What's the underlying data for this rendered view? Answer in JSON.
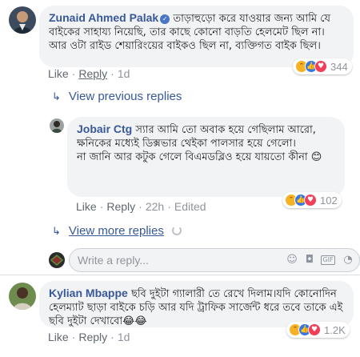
{
  "comments": [
    {
      "author": "Zunaid Ahmed Palak",
      "verified": true,
      "text": "তাড়াহুড়ো করে যাওয়ার জন্য আমি যে বাইকের সাহায্য নিয়েছি, তার কাছে কোনো বাড়তি হেলমেট ছিল না। আর ওটা রাইড শেয়ারিংয়ের বাইকও ছিল না, ব্যক্তিগত বাইক ছিল।",
      "like": "Like",
      "reply": "Reply",
      "time": "1d",
      "reaction_count": "344"
    },
    {
      "author": "Jobair Ctg",
      "text_lines": [
        "স্যার আমি তো অবাক হয়ে গেছিলাম আরো,",
        "ক্ষনিকের মধ্যেই ডিক্সভার থেইকা পালসার হয়ে গেলো।",
        "না জানি আর কটুক গেলে বিএমডব্লিও হয়ে যায়তো কীনা 😊"
      ],
      "like": "Like",
      "reply": "Reply",
      "time": "22h",
      "edited": "Edited",
      "reaction_count": "102"
    },
    {
      "author": "Kylian Mbappe",
      "text": "ছবি দুইটা গ্যালারী তে রেখে দিলাম।যদি কোনোদিন হেলম্যাট ছাড়া বাইকে চড়ি আর যদি ট্রাফিক সার্জেন্ট ধরে তবে তাকে এই ছবি দুইটা দেখাবো😂😂",
      "like": "Like",
      "reply": "Reply",
      "time": "1d",
      "reaction_count": "1.2K"
    }
  ],
  "view_previous": "View previous replies",
  "view_more": "View more replies",
  "write_reply_placeholder": "Write a reply...",
  "icons": {
    "reply_arrow": "reply-arrow-icon",
    "verified": "verified-badge-icon",
    "emoji": "emoji-icon",
    "camera": "camera-icon",
    "gif": "gif-icon",
    "sticker": "sticker-icon"
  },
  "colors": {
    "link": "#385898",
    "bubble": "#f2f3f5",
    "haha": "#f7b125",
    "like": "#3578e5",
    "love": "#f33e58"
  }
}
